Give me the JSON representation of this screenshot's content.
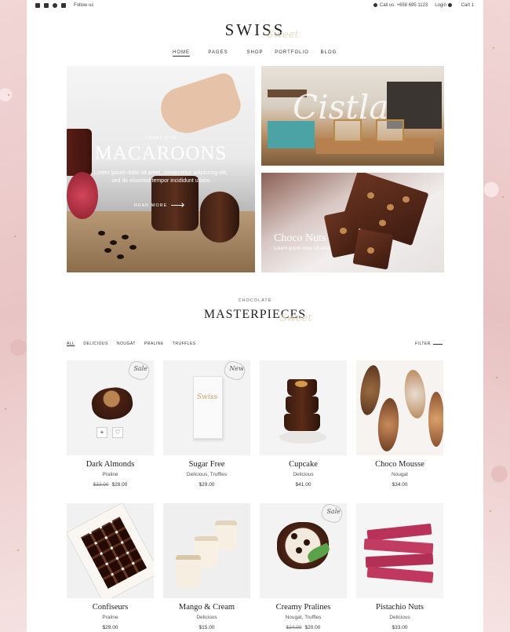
{
  "topbar": {
    "follow": "Follow us",
    "phone": "Call us: +658 695 1123",
    "login": "Login",
    "cart": "Cart 1"
  },
  "logo": {
    "text": "SWISS",
    "script": "Sweet"
  },
  "nav": {
    "items": [
      "HOME",
      "PAGES",
      "SHOP",
      "PORTFOLIO",
      "BLOG"
    ],
    "active": "HOME"
  },
  "hero": {
    "kicker": "SWEET BITE",
    "title": "MACAROONS",
    "text": "Lorem ipsum dolor sit amet, consectetur adipiscing elit, sed do eiusmod tempor incididunt utlabo",
    "button": "READ MORE",
    "banner2_script": "Cistla",
    "banner3_title": "Choco Nuts",
    "banner3_text": "Lorem ipsum dolor sit amet"
  },
  "section": {
    "kicker": "CHOCOLATE",
    "title": "MASTERPIECES",
    "script": "Sweet"
  },
  "filters": {
    "items": [
      "ALL",
      "DELICIOUS",
      "NOUGAT",
      "PRALINE",
      "TRUFFLES"
    ],
    "active": "ALL",
    "filter_label": "FILTER"
  },
  "products": [
    {
      "name": "Dark Almonds",
      "category": "Praline",
      "old_price": "$32.00",
      "price": "$28.00",
      "badge": "Sale"
    },
    {
      "name": "Sugar Free",
      "category": "Delicious, Truffles",
      "old_price": "",
      "price": "$29.00",
      "badge": "New",
      "pack_logo": "Swiss"
    },
    {
      "name": "Cupcake",
      "category": "Delicious",
      "old_price": "",
      "price": "$41.00",
      "badge": ""
    },
    {
      "name": "Choco Mousse",
      "category": "Nougat",
      "old_price": "",
      "price": "$34.00",
      "badge": ""
    },
    {
      "name": "Confiseurs",
      "category": "Praline",
      "old_price": "",
      "price": "$29.00",
      "badge": ""
    },
    {
      "name": "Mango & Cream",
      "category": "Delicious",
      "old_price": "",
      "price": "$15.00",
      "badge": ""
    },
    {
      "name": "Creamy Pralines",
      "category": "Nougat, Truffles",
      "old_price": "$24.00",
      "price": "$20.00",
      "badge": "Sale"
    },
    {
      "name": "Pistachio Nuts",
      "category": "Delicious",
      "old_price": "",
      "price": "$33.00",
      "badge": ""
    }
  ],
  "card_actions": {
    "add": "+",
    "wishlist": "♡"
  }
}
